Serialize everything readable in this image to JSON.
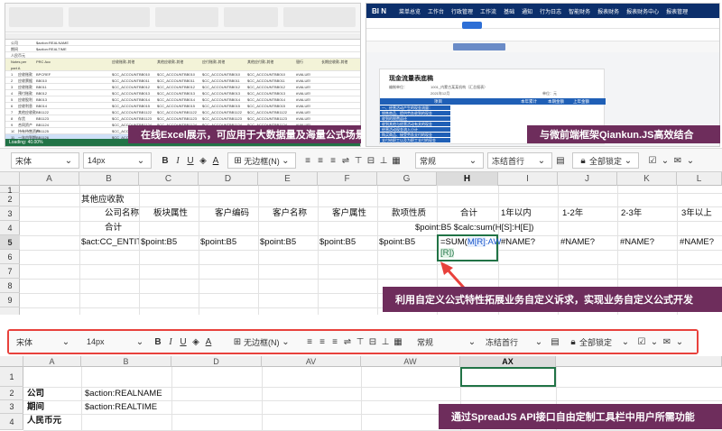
{
  "top_left": {
    "title_rows": [
      "公司",
      "期间",
      "人民币元"
    ],
    "actions": [
      "$action:REALNAME",
      "$action:REALTIME"
    ],
    "header_row": [
      "Notes per part A",
      "PRC Acc",
      "",
      "应收账款-其他",
      "其他应收款-其他",
      "应付账款-其他",
      "其他应付款-其他",
      "银行",
      "长期应收款-其他"
    ],
    "rows": [
      [
        "1",
        "应收账款",
        "BPCREF",
        "$CC_ACCOUNTBB010",
        "$CC_ACCOUNTBB010",
        "$CC_ACCOUNTBB010",
        "$CC_ACCOUNTBB010",
        "#VALUE!"
      ],
      [
        "2",
        "应收票据",
        "BB010",
        "$CC_ACCOUNTBB011",
        "$CC_ACCOUNTBB011",
        "$CC_ACCOUNTBB011",
        "$CC_ACCOUNTBB011",
        "#VALUE!"
      ],
      [
        "3",
        "应收账款",
        "BB011",
        "$CC_ACCOUNTBB012",
        "$CC_ACCOUNTBB012",
        "$CC_ACCOUNTBB012",
        "$CC_ACCOUNTBB012",
        "#VALUE!"
      ],
      [
        "4",
        "预付账款",
        "BB012",
        "$CC_ACCOUNTBB013",
        "$CC_ACCOUNTBB013",
        "$CC_ACCOUNTBB013",
        "$CC_ACCOUNTBB013",
        "#VALUE!"
      ],
      [
        "5",
        "应收股利",
        "BB013",
        "$CC_ACCOUNTBB014",
        "$CC_ACCOUNTBB014",
        "$CC_ACCOUNTBB014",
        "$CC_ACCOUNTBB014",
        "#VALUE!"
      ],
      [
        "6",
        "应收利息",
        "BB014",
        "$CC_ACCOUNTBB015",
        "$CC_ACCOUNTBB015",
        "$CC_ACCOUNTBB015",
        "$CC_ACCOUNTBB015",
        "#VALUE!"
      ],
      [
        "7",
        "其他应收款",
        "BB1122",
        "$CC_ACCOUNTBB1122",
        "$CC_ACCOUNTBB1122",
        "$CC_ACCOUNTBB1122",
        "$CC_ACCOUNTBB1122",
        "#VALUE!"
      ],
      [
        "8",
        "存货",
        "BB1123",
        "$CC_ACCOUNTBB1123",
        "$CC_ACCOUNTBB1123",
        "$CC_ACCOUNTBB1123",
        "$CC_ACCOUNTBB1123",
        "#VALUE!"
      ],
      [
        "9",
        "合同资产",
        "BB1124",
        "$CC_ACCOUNTBB1124",
        "$CC_ACCOUNTBB1124",
        "$CC_ACCOUNTBB1124",
        "$CC_ACCOUNTBB1124",
        "#VALUE!"
      ],
      [
        "10",
        "持有待售资产",
        "BB1125",
        "$CC_ACCOUNTBB1125",
        "$CC_ACCOUNTBB1125",
        "$CC_ACCOUNTBB1125",
        "$CC_ACCOUNTBB1125",
        "#VALUE!"
      ],
      [
        "11",
        "一年内到期",
        "BB1126",
        "$CC_ACCOUNTBB1126",
        "$CC_ACCOUNTBB1126",
        "$CC_ACCOUNTBB1126",
        "$CC_ACCOUNTBB1126",
        "#VALUE!"
      ],
      [
        "12",
        "其他流动资产",
        "BB1127",
        "$CC_ACCOUNTBB1127",
        "$CC_ACCOUNTBB1127",
        "$CC_ACCOUNTBB1127",
        "$CC_ACCOUNTBB1127",
        "#VALUE!"
      ],
      [
        "13",
        "债权投资",
        "BB1128",
        "$CC_ACCOUNTBB1128",
        "$CC_ACCOUNTBB1128",
        "$CC_ACCOUNTBB1128",
        "$CC_ACCOUNTBB1128",
        "#VALUE!"
      ],
      [
        "14",
        "其他债权投资",
        "BB1129",
        "$CC_ACCOUNTBB1129",
        "$CC_ACCOUNTBB1129",
        "$CC_ACCOUNTBB1129",
        "$CC_ACCOUNTBB1129",
        "#VALUE!"
      ]
    ],
    "status": "Loading: 40.00%",
    "banner": "在线Excel展示，可应用于大数据量及海量公式场景"
  },
  "top_right": {
    "logo": "BI N",
    "nav": [
      "菜单总览",
      "工作台",
      "工作台",
      "行政管理",
      "工作流",
      "基础",
      "通知",
      "行为日志",
      "智能财务",
      "报表财务",
      "报表财务中心",
      "报表管理",
      "项目管理",
      "审批流程"
    ],
    "doc_title": "现金流量表底稿",
    "meta": [
      "编制单位：",
      "1001_内蒙古某某机构（汇总报表）",
      "2021年12月",
      "单位：元"
    ],
    "table_header": [
      "项目",
      "本年累计",
      "本期金额",
      "上年金额",
      "合计"
    ],
    "table_rows": [
      "一、经营活动产生的现金流量：",
      "销售商品、提供劳务收到的现金",
      "收到的税费返还",
      "收到其他与经营活动有关的现金",
      "经营活动现金流入小计",
      "购买商品、接受劳务支付的现金",
      "支付给职工以及为职工支付的现金"
    ],
    "banner": "与微前端框架Qiankun.JS高效结合"
  },
  "mid_sheet": {
    "toolbar": {
      "font": "宋体",
      "size": "14px",
      "border": "无边框(N)",
      "format": "常规",
      "freeze": "冻结首行",
      "lock": "全部锁定"
    },
    "columns": [
      "A",
      "B",
      "C",
      "D",
      "E",
      "F",
      "G",
      "H",
      "I",
      "J",
      "K",
      "L"
    ],
    "rows": [
      "1",
      "2",
      "3",
      "4",
      "5",
      "6",
      "7",
      "8",
      "9"
    ],
    "r2": {
      "b": "其他应收款"
    },
    "r3": {
      "b": "公司名称",
      "c": "板块属性",
      "d": "客户编码",
      "e": "客户名称",
      "f": "客户属性",
      "g": "款项性质",
      "h": "合计",
      "i": "1年以内",
      "j": "1-2年",
      "k": "2-3年",
      "l": "3年以上"
    },
    "r4": {
      "b": "合计",
      "g": "$point:B5 $calc:sum(H[S]:H[E])"
    },
    "r5": {
      "b": "$act:CC_ENTIT",
      "c": "$point:B5",
      "d": "$point:B5",
      "e": "$point:B5",
      "f": "$point:B5",
      "g": "$point:B5",
      "h_prefix": "=SUM(",
      "h_ref": "M[R]",
      "h_mid": ":AW",
      "h_end": "[R])",
      "i": "#NAME?",
      "j": "#NAME?",
      "k": "#NAME?",
      "l": "#NAME?"
    },
    "banner": "利用自定义公式特性拓展业务自定义诉求，实现业务自定义公式开发"
  },
  "bottom_sheet": {
    "toolbar": {
      "font": "宋体",
      "size": "14px",
      "border": "无边框(N)",
      "format": "常规",
      "freeze": "冻结首行",
      "lock": "全部锁定"
    },
    "columns": [
      "A",
      "B",
      "D",
      "AV",
      "AW",
      "AX"
    ],
    "rows": [
      "1",
      "2",
      "3",
      "4"
    ],
    "cells": [
      {
        "a": "公司",
        "b": "$action:REALNAME"
      },
      {
        "a": "期间",
        "b": "$action:REALTIME"
      },
      {
        "a": "人民币元",
        "b": ""
      }
    ],
    "banner": "通过SpreadJS API接口自由定制工具栏中用户所需功能"
  },
  "colors": {
    "banner": "#6e2d5c",
    "highlight": "#e8413c",
    "nav": "#0c2f6b",
    "excel_green": "#217346"
  }
}
